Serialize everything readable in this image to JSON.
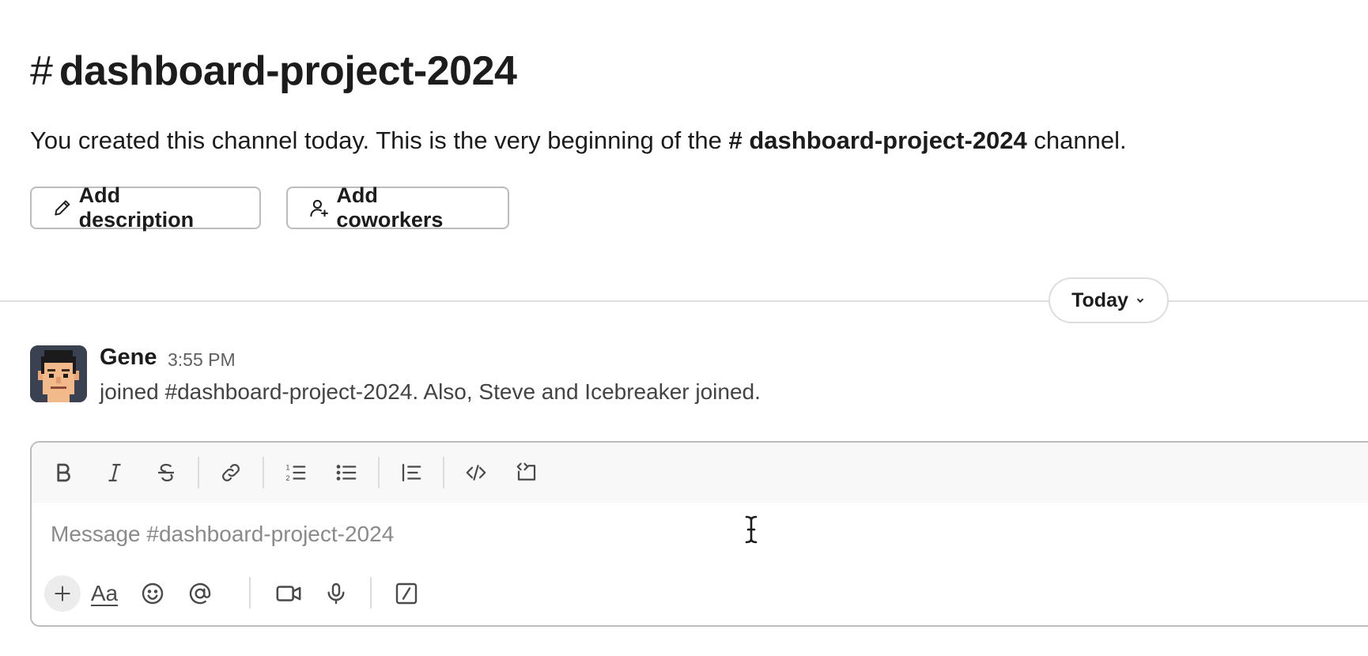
{
  "channel": {
    "hash": "#",
    "name": "dashboard-project-2024",
    "intro_prefix": "You created this channel today. This is the very beginning of the ",
    "intro_channel": "# dashboard-project-2024",
    "intro_suffix": " channel."
  },
  "actions": {
    "add_description": "Add description",
    "add_coworkers": "Add coworkers"
  },
  "divider": {
    "label": "Today"
  },
  "message": {
    "author": "Gene",
    "time": "3:55 PM",
    "text": "joined #dashboard-project-2024. Also, Steve and Icebreaker joined."
  },
  "composer": {
    "placeholder": "Message #dashboard-project-2024",
    "format_buttons": [
      "bold-icon",
      "italic-icon",
      "strikethrough-icon",
      "link-icon",
      "ordered-list-icon",
      "bulleted-list-icon",
      "blockquote-icon",
      "code-icon",
      "code-block-icon"
    ],
    "action_buttons": [
      "plus-icon",
      "text-format-icon",
      "emoji-icon",
      "mention-icon",
      "video-icon",
      "microphone-icon",
      "slash-command-icon"
    ],
    "text_format_label": "Aa"
  }
}
